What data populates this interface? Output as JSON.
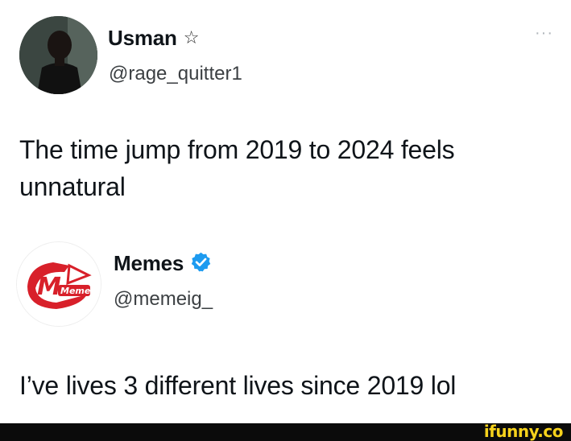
{
  "posts": [
    {
      "display_name": "Usman",
      "badge_icon": "star-outline-icon",
      "handle": "@rage_quitter1",
      "text": "The time jump from 2019 to 2024 feels unnatural",
      "more_icon": "ellipsis-icon"
    },
    {
      "display_name": "Memes",
      "badge_icon": "verified-checkmark-icon",
      "handle": "@memeig_",
      "text": "I’ve lives 3 different lives since 2019 lol",
      "logo_text": "Memes",
      "accent_color": "#d8202a",
      "verified_color": "#1d9bf0"
    }
  ],
  "watermark": {
    "text": "ifunny.co",
    "color": "#f6d21c"
  }
}
